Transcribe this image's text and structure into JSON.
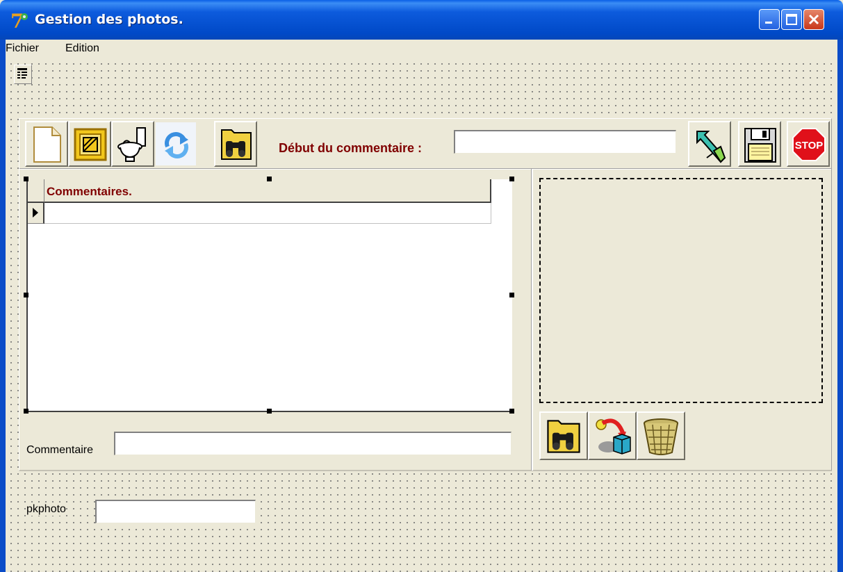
{
  "window": {
    "title": "Gestion des photos."
  },
  "menu": {
    "items": [
      "Fichier",
      "Edition"
    ]
  },
  "toolbar": {
    "left_buttons": [
      {
        "icon": "new-document-icon"
      },
      {
        "icon": "edit-frame-icon"
      },
      {
        "icon": "toilet-delete-icon"
      },
      {
        "icon": "refresh-icon"
      },
      {
        "icon": "binoculars-search-icon"
      }
    ],
    "debut_label": "Début du commentaire :",
    "debut_value": "",
    "right_buttons": [
      {
        "icon": "arrow-select-icon"
      },
      {
        "icon": "floppy-save-icon"
      },
      {
        "icon": "stop-icon",
        "text": "STOP"
      }
    ]
  },
  "grid": {
    "column_header": "Commentaires.",
    "rows": [
      ""
    ]
  },
  "commentaire": {
    "label": "Commentaire",
    "value": ""
  },
  "image_buttons": [
    {
      "icon": "binoculars-search-icon"
    },
    {
      "icon": "import-image-icon"
    },
    {
      "icon": "basket-delete-icon"
    }
  ],
  "pkphoto": {
    "label": "pkphoto",
    "value": ""
  },
  "colors": {
    "label_accent": "#800000",
    "titlebar": "#0054E3",
    "face": "#ECE9D8"
  }
}
